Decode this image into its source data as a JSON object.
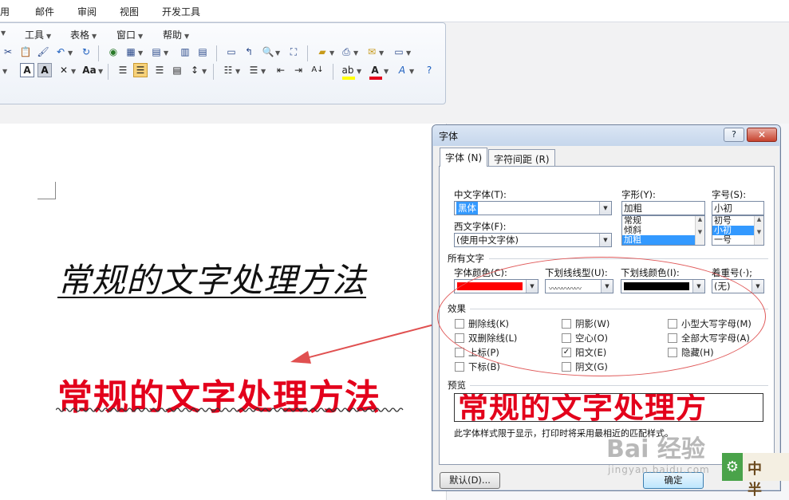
{
  "ribbon_tabs": [
    "用",
    "邮件",
    "审阅",
    "视图",
    "开发工具"
  ],
  "menu": [
    "工具",
    "表格",
    "窗口",
    "帮助"
  ],
  "toolbar": {
    "row2_icons": [
      "cut-icon",
      "paste-icon",
      "format-painter-icon",
      "undo-icon",
      "redo-icon",
      "hyperlink-icon",
      "table-icon",
      "insert-table-icon",
      "columns-icon",
      "text-box-icon",
      "comment-icon",
      "paragraph-mark-icon",
      "zoom-icon",
      "full-screen-icon",
      "folder-icon",
      "print-icon",
      "envelope-icon",
      "border-icon"
    ],
    "format_labels": {
      "char_border": "A",
      "char_shading": "A",
      "change_case": "Aa"
    },
    "font_color": "#e3001b",
    "highlight_color": "#ffff00"
  },
  "document": {
    "line1": "常规的文字处理方法",
    "line2": "常规的文字处理方法"
  },
  "dialog": {
    "title": "字体",
    "help_label": "?",
    "close_label": "✕",
    "tabs": [
      "字体 (N)",
      "字符间距 (R)"
    ],
    "chinese_font_label": "中文字体(T):",
    "chinese_font_value": "黑体",
    "western_font_label": "西文字体(F):",
    "western_font_value": "(使用中文字体)",
    "style_label": "字形(Y):",
    "style_value": "加粗",
    "style_options": [
      "常规",
      "倾斜",
      "加粗"
    ],
    "style_selected": 2,
    "size_label": "字号(S):",
    "size_value": "小初",
    "size_options": [
      "初号",
      "小初",
      "一号"
    ],
    "size_selected": 1,
    "all_text_label": "所有文字",
    "font_color_label": "字体颜色(C):",
    "font_color": "#ff0000",
    "underline_style_label": "下划线线型(U):",
    "underline_color_label": "下划线颜色(I):",
    "underline_color": "#000000",
    "emphasis_label": "着重号(·);",
    "emphasis_value": "(无)",
    "effects_label": "效果",
    "effects": [
      {
        "label": "删除线(K)",
        "checked": false
      },
      {
        "label": "双删除线(L)",
        "checked": false
      },
      {
        "label": "上标(P)",
        "checked": false
      },
      {
        "label": "下标(B)",
        "checked": false
      },
      {
        "label": "阴影(W)",
        "checked": false
      },
      {
        "label": "空心(O)",
        "checked": false
      },
      {
        "label": "阳文(E)",
        "checked": true
      },
      {
        "label": "阴文(G)",
        "checked": false
      },
      {
        "label": "小型大写字母(M)",
        "checked": false
      },
      {
        "label": "全部大写字母(A)",
        "checked": false
      },
      {
        "label": "隐藏(H)",
        "checked": false
      }
    ],
    "preview_label": "预览",
    "preview_text": "常规的文字处理方",
    "preview_note": "此字体样式限于显示，打印时将采用最相近的匹配样式。",
    "default_button": "默认(D)...",
    "ok_button": "确定"
  },
  "watermark": {
    "brand": "Bai 经验",
    "url": "jingyan.baidu.com",
    "corner": "中 半"
  }
}
